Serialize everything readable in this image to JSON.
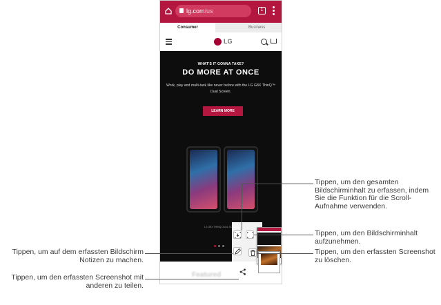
{
  "browser": {
    "url_domain": "lg.com",
    "url_path": "/us",
    "tab_count": "1",
    "icons": [
      "home-icon",
      "lock-icon",
      "tabs-icon",
      "more-icon"
    ],
    "accent_color": "#b3163e"
  },
  "site_tabs": [
    "Consumer",
    "Business"
  ],
  "site_header": {
    "logo_text": "LG",
    "icons": [
      "menu-icon",
      "search-icon",
      "cart-icon"
    ]
  },
  "hero": {
    "kicker": "WHAT'S IT GONNA TAKE?",
    "headline": "DO MORE AT ONCE",
    "description": "Work, play and multi-task like never before with the LG G8X ThinQ™ Dual Screen.",
    "cta": "LEARN MORE",
    "caption": "LG G8X THINQ DUAL SCREEN"
  },
  "section_heading": "Featured",
  "callouts": {
    "capture_all": "Tippen, um den gesamten Bildschirminhalt zu erfassen, indem Sie die Funktion für die Scroll-Aufnahme verwenden.",
    "capture": "Tippen, um den Bildschirminhalt aufzunehmen.",
    "delete": "Tippen, um den erfassten Screenshot zu löschen.",
    "edit": "Tippen, um auf dem erfassten Bildschirm Notizen zu machen.",
    "share": "Tippen, um den erfassten Screenshot mit anderen zu teilen."
  }
}
